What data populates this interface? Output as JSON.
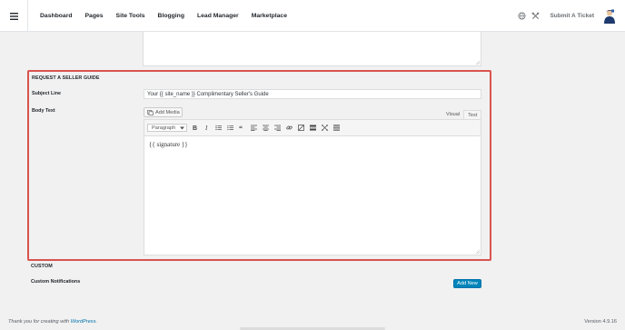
{
  "nav": {
    "items": [
      {
        "label": "Dashboard"
      },
      {
        "label": "Pages"
      },
      {
        "label": "Site Tools"
      },
      {
        "label": "Blogging"
      },
      {
        "label": "Lead Manager"
      },
      {
        "label": "Marketplace"
      }
    ],
    "submit_ticket": "Submit A Ticket"
  },
  "seller_guide": {
    "section_title": "REQUEST A SELLER GUIDE",
    "subject_label": "Subject Line",
    "subject_value": "Your {{ site_name }} Complimentary Seller's Guide",
    "body_label": "Body Text",
    "add_media": "Add Media",
    "tabs": {
      "visual": "Visual",
      "text": "Text"
    },
    "format_select": "Paragraph",
    "content": "{{ signature }}"
  },
  "custom": {
    "section_title": "CUSTOM",
    "notifications_label": "Custom Notifications",
    "add_new": "Add New"
  },
  "footer": {
    "thanks_prefix": "Thank you for creating with",
    "thanks_link": "WordPress",
    "thanks_suffix": ".",
    "version": "Version 4.9.16"
  },
  "colors": {
    "highlight": "#d9534f",
    "primary_button": "#0085ba",
    "link": "#0073aa"
  }
}
